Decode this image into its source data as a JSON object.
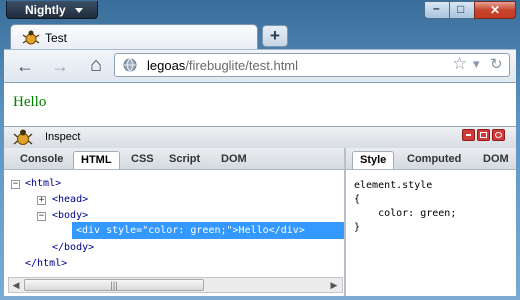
{
  "window": {
    "app_button_label": "Nightly",
    "controls": {
      "minimize": "–",
      "maximize": "□",
      "close": "✕"
    }
  },
  "tabs": [
    {
      "title": "Test"
    }
  ],
  "new_tab_label": "+",
  "navigation": {
    "back_icon": "←",
    "forward_icon": "→",
    "home_icon": "⌂",
    "url_host": "legoas",
    "url_path": "/firebuglite/test.html",
    "bookmark_star_icon": "☆",
    "dropdown_icon": "▾",
    "reload_icon": "↻"
  },
  "page": {
    "text": "Hello",
    "text_color": "#008000"
  },
  "firebug": {
    "inspect_label": "Inspect",
    "left_tabs": [
      "Console",
      "HTML",
      "CSS",
      "Script",
      "DOM"
    ],
    "left_selected_tab": "HTML",
    "right_tabs": [
      "Style",
      "Computed",
      "DOM"
    ],
    "right_selected_tab": "Style",
    "html_tree": [
      {
        "toggle": "−",
        "text": "<html>"
      },
      {
        "toggle": "+",
        "text": "<head>"
      },
      {
        "toggle": "−",
        "text": "<body>"
      },
      {
        "toggle": "",
        "text": "<div style=\"color: green;\">Hello</div>",
        "selected": true
      },
      {
        "toggle": "",
        "text": "</body>"
      },
      {
        "toggle": "",
        "text": "</html>"
      }
    ],
    "style_rules": [
      "element.style",
      "{",
      "    color: green;",
      "}"
    ],
    "selection_color": "#3399ff",
    "scrollbar": {
      "left_arrow": "◀",
      "right_arrow": "▶",
      "grip": "|||"
    }
  }
}
